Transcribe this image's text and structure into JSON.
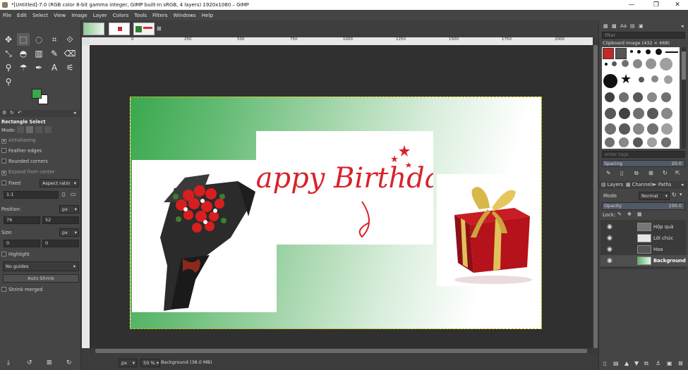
{
  "window": {
    "title": "*[Untitled]-7.0 (RGB color 8-bit gamma integer, GIMP built-in sRGB, 4 layers) 1920x1080 – GIMP",
    "minimize": "—",
    "maximize": "❐",
    "close": "✕"
  },
  "menu": [
    "File",
    "Edit",
    "Select",
    "View",
    "Image",
    "Layer",
    "Colors",
    "Tools",
    "Filters",
    "Windows",
    "Help"
  ],
  "toolbox": {
    "tool_name": "Rectangle Select",
    "mode_label": "Mode:",
    "antialiasing": "Antialiasing",
    "feather_edges": "Feather edges",
    "rounded_corners": "Rounded corners",
    "expand_from_center": "Expand from center",
    "fixed_label": "Fixed",
    "aspect_ratio": "Aspect ratio",
    "ratio_value": "1:1",
    "position_label": "Position:",
    "position_unit": "px",
    "pos_x": "76",
    "pos_y": "52",
    "size_label": "Size:",
    "size_unit": "px",
    "size_w": "0",
    "size_h": "0",
    "highlight": "Highlight",
    "guides": "No guides",
    "auto_shrink": "Auto Shrink",
    "shrink_merged": "Shrink merged",
    "fg_color": "#3aa84e",
    "bg_color": "#ffffff"
  },
  "ruler": {
    "labels": [
      "0",
      "250",
      "500",
      "750",
      "1000",
      "1250",
      "1500",
      "1750",
      "2000"
    ]
  },
  "image": {
    "greeting": "Happy Birthday"
  },
  "status": {
    "unit": "px",
    "zoom": "50 %",
    "info": "Background (38.0 MB)"
  },
  "brushes": {
    "filter_placeholder": "filter",
    "title": "Clipboard Image (432 × 468)",
    "tag_placeholder": "enter tags",
    "spacing_label": "Spacing",
    "spacing_value": "20.0"
  },
  "layers_panel": {
    "tabs": [
      "Layers",
      "Channels",
      "Paths"
    ],
    "mode_label": "Mode",
    "mode_value": "Normal",
    "opacity_label": "Opacity",
    "opacity_value": "100.0",
    "lock_label": "Lock:",
    "layers": [
      {
        "name": "Hộp quà"
      },
      {
        "name": "Lời chúc"
      },
      {
        "name": "Hoa"
      },
      {
        "name": "Background"
      }
    ]
  }
}
